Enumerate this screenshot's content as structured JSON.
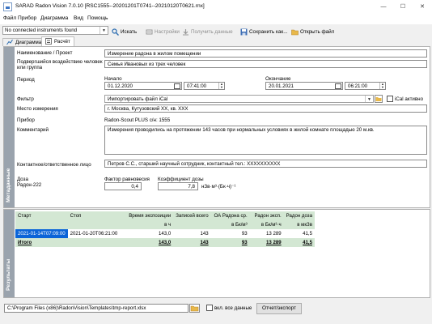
{
  "window": {
    "title": "SARAD Radon Vision 7.0.10 [RSC1555--20201201T0741--20210120T0621.rnx]",
    "minimize": "—",
    "maximize": "☐",
    "close": "✕"
  },
  "menu": [
    "Файл",
    "Прибор",
    "Диаграмма",
    "Вид",
    "Помощь"
  ],
  "toolbar": {
    "instrument_select": "No connected instruments found",
    "search": "Искать",
    "settings": "Настройки",
    "get_data": "Получить данные",
    "save_as": "Сохранить как...",
    "open_file": "Открыть файл"
  },
  "tabs": [
    "Диаграмма",
    "Расчёт"
  ],
  "metadata": {
    "section_label": "Метаданные",
    "name_label": "Наименование / Проект",
    "name_value": "Измерение радона в жилом помещении",
    "person_label": "Подвергшийся воздействию человек или группа",
    "person_value": "Семья Ивановых из трех человек",
    "period_label": "Период",
    "start_label": "Начало",
    "start_date": "01.12.2020",
    "start_time": "07:41:00",
    "end_label": "Окончание",
    "end_date": "20.01.2021",
    "end_time": "06:21:00",
    "filter_label": "Фильтр",
    "filter_value": "Импортировать файл iCal",
    "ical_label": "iCal активно",
    "location_label": "Место измерения",
    "location_value": "г. Москва, Кутузовский ХХ, кв. ХХХ",
    "device_label": "Прибор",
    "device_value": "Radon-Scout PLUS с/н: 1555",
    "comment_label": "Комментарий",
    "comment_value": "Измерения проводились на протяжении 143 часов при нормальных условиях в жилой комнате площадью 20 м.кв.",
    "contact_label": "Контактное/ответственное лицо",
    "contact_value": "Петров С.С., старший научный сотрудник, контактный тел.: ХХХХХХХХХХ",
    "dose_label": "Доза",
    "dose_model": "Радон-222",
    "equilibrium_label": "Фактор равновесия",
    "equilibrium_value": "0,4",
    "dose_coef_label": "Коэффициент дозы",
    "dose_coef_value": "7,8",
    "dose_coef_unit": "нЗв·м³·(Бк·ч)⁻¹"
  },
  "results": {
    "section_label": "Результаты",
    "headers": [
      "Старт",
      "Стоп",
      "Время экспозиции",
      "Записей всего",
      "ОА Радона ср.",
      "Радон эксп.",
      "Радон доза"
    ],
    "units": [
      "",
      "",
      "в ч",
      "",
      "в Бк/м³",
      "в Бк/м³·ч",
      "в мкЗв"
    ],
    "rows": [
      [
        "2021-01-14T07:09:00",
        "2021-01-20T06:21:00",
        "143,0",
        "143",
        "93",
        "13 289",
        "41,5"
      ]
    ],
    "total": [
      "Итого",
      "",
      "143,0",
      "143",
      "93",
      "13 289",
      "41,5"
    ]
  },
  "footer": {
    "template_path": "C:\\Program Files (x86)\\RadonVision\\Templates\\tmp-report.xlsx",
    "include_all_label": "вкл. все данные",
    "report_button": "Отчет/экспорт"
  },
  "colors": {
    "accent": "#0a64d8",
    "strip": "#9aa3ad",
    "table_header": "#d3e7d3"
  }
}
